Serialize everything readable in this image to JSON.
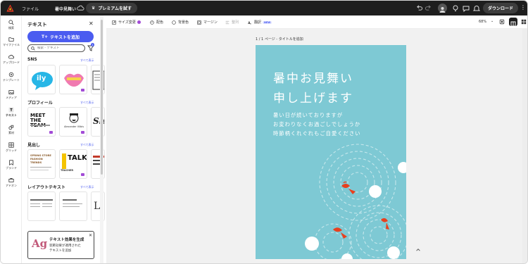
{
  "topbar": {
    "file_label": "ファイル",
    "doc_title": "暑中見舞い",
    "premium_label": "プレミアムを試す",
    "download_label": "ダウンロード"
  },
  "rail": {
    "items": [
      {
        "label": "検索",
        "icon": "search-icon"
      },
      {
        "label": "マイファイル",
        "icon": "folder-icon"
      },
      {
        "label": "アップロード",
        "icon": "upload-icon"
      },
      {
        "label": "テンプレート",
        "icon": "template-icon"
      },
      {
        "label": "メディア",
        "icon": "media-icon"
      },
      {
        "label": "テキスト",
        "icon": "text-icon"
      },
      {
        "label": "素材",
        "icon": "elements-icon"
      },
      {
        "label": "グリッド",
        "icon": "grid-icon"
      },
      {
        "label": "ブランド",
        "icon": "brand-icon"
      },
      {
        "label": "アドオン",
        "icon": "addon-icon"
      }
    ]
  },
  "panel": {
    "title": "テキスト",
    "add_text_label": "テキストを追加",
    "search_placeholder": "検索 - テキスト",
    "filter_count": "1",
    "sections": [
      {
        "title": "SNS",
        "link": "すべて表示"
      },
      {
        "title": "プロフィール",
        "link": "すべて表示"
      },
      {
        "title": "見出し",
        "link": "すべて表示"
      },
      {
        "title": "レイアウトテキスト",
        "link": "すべて表示"
      }
    ],
    "thumbs": {
      "sns_bubble": "ily",
      "profile_meet": "MEET THE TEAM",
      "profile_name": "Alexander Vilbis",
      "heading_talk": "TALK",
      "heading_teacher": "TEACHER",
      "heading_fashion": "SPRING STORE FASHION TRENDS"
    },
    "fx_card": {
      "ag": "Ag",
      "title": "テキスト効果を生成",
      "desc_line1": "装飾効果が適用された",
      "desc_line2": "テキストを追加"
    }
  },
  "toolbar": {
    "resize_label": "サイズ変更",
    "color_label": "配色",
    "background_label": "背景色",
    "margin_label": "マージン",
    "align_label": "整列",
    "translate_label": "翻訳",
    "new_badge": "NEW",
    "zoom": "68%"
  },
  "canvas": {
    "page_label": "1 / 1 ページ - タイトルを追加",
    "poster": {
      "title_line1": "暑中お見舞い",
      "title_line2": "申し上げます",
      "body_line1": "暑い日が続いておりますが",
      "body_line2": "お変わりなくお過ごしでしょうか",
      "body_line3": "時節柄くれぐれもご自愛ください",
      "background": "#7ec9d4"
    }
  }
}
